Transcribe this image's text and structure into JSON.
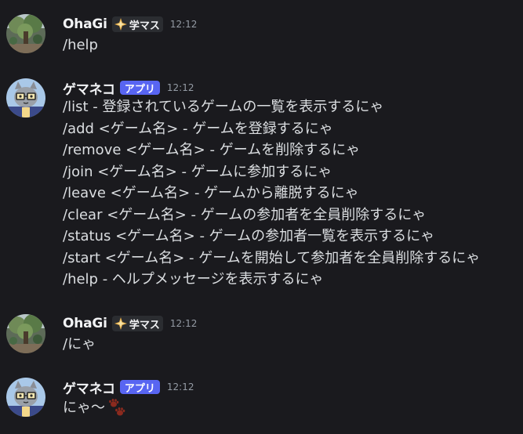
{
  "messages": [
    {
      "author": "OhaGi",
      "badge": "学マス",
      "time": "12:12",
      "lines": [
        "/help"
      ]
    },
    {
      "author": "ゲマネコ",
      "badge": "アプリ",
      "time": "12:12",
      "lines": [
        "/list - 登録されているゲームの一覧を表示するにゃ",
        "/add <ゲーム名> - ゲームを登録するにゃ",
        "/remove <ゲーム名> - ゲームを削除するにゃ",
        "/join <ゲーム名> - ゲームに参加するにゃ",
        "/leave <ゲーム名> - ゲームから離脱するにゃ",
        "/clear <ゲーム名> - ゲームの参加者を全員削除するにゃ",
        "/status <ゲーム名> - ゲームの参加者一覧を表示するにゃ",
        "/start <ゲーム名> - ゲームを開始して参加者を全員削除するにゃ",
        "/help - ヘルプメッセージを表示するにゃ"
      ]
    },
    {
      "author": "OhaGi",
      "badge": "学マス",
      "time": "12:12",
      "lines": [
        "/にゃ"
      ]
    },
    {
      "author": "ゲマネコ",
      "badge": "アプリ",
      "time": "12:12",
      "lines": [
        "にゃ～"
      ]
    }
  ],
  "icons": {
    "user_avatar": "tree-photo-avatar",
    "bot_avatar": "cat-with-glasses-avatar",
    "game_badge_icon": "sparkle-icon",
    "emoji": "paw-prints-emoji"
  },
  "colors": {
    "background": "#1a1a1e",
    "app_badge": "#5865f2",
    "text": "#dbdee1",
    "timestamp": "#949ba4"
  }
}
